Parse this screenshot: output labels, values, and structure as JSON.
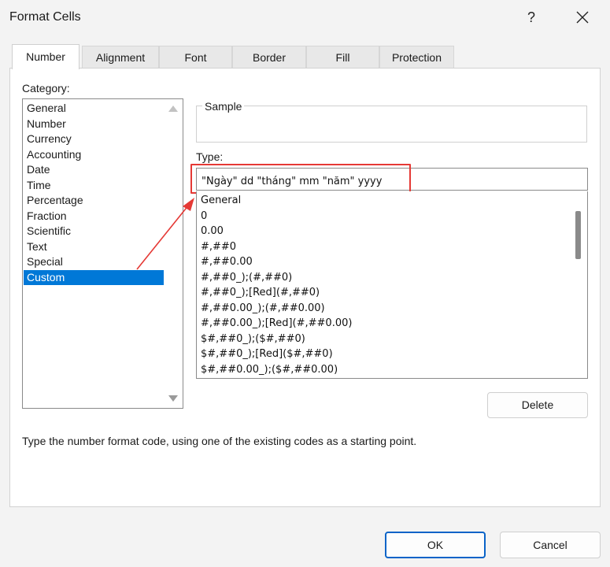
{
  "window": {
    "title": "Format Cells",
    "help_label": "?"
  },
  "tabs": [
    {
      "label": "Number",
      "active": true
    },
    {
      "label": "Alignment",
      "active": false
    },
    {
      "label": "Font",
      "active": false
    },
    {
      "label": "Border",
      "active": false
    },
    {
      "label": "Fill",
      "active": false
    },
    {
      "label": "Protection",
      "active": false
    }
  ],
  "category": {
    "label": "Category:",
    "items": [
      "General",
      "Number",
      "Currency",
      "Accounting",
      "Date",
      "Time",
      "Percentage",
      "Fraction",
      "Scientific",
      "Text",
      "Special",
      "Custom"
    ],
    "selected": "Custom"
  },
  "sample": {
    "label": "Sample"
  },
  "type": {
    "label": "Type:",
    "value": "\"Ngày\" dd \"tháng\" mm \"năm\" yyyy",
    "formats": [
      "General",
      "0",
      "0.00",
      "#,##0",
      "#,##0.00",
      "#,##0_);(#,##0)",
      "#,##0_);[Red](#,##0)",
      "#,##0.00_);(#,##0.00)",
      "#,##0.00_);[Red](#,##0.00)",
      "$#,##0_);($#,##0)",
      "$#,##0_);[Red]($#,##0)",
      "$#,##0.00_);($#,##0.00)"
    ]
  },
  "buttons": {
    "delete": "Delete",
    "ok": "OK",
    "cancel": "Cancel"
  },
  "hint": "Type the number format code, using one of the existing codes as a starting point.",
  "colors": {
    "selection": "#0078d7",
    "annotation": "#e53935",
    "ok_border": "#0a64c8"
  }
}
